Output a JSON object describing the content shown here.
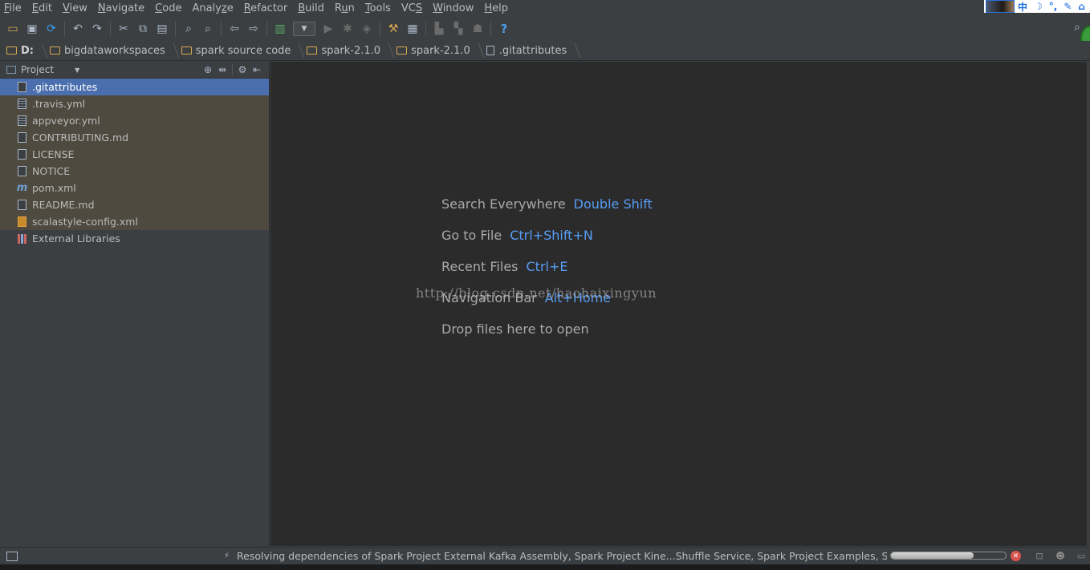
{
  "menubar": {
    "items": [
      {
        "mnemonic": "F",
        "rest": "ile"
      },
      {
        "mnemonic": "E",
        "rest": "dit"
      },
      {
        "mnemonic": "V",
        "rest": "iew"
      },
      {
        "mnemonic": "N",
        "rest": "avigate"
      },
      {
        "mnemonic": "C",
        "rest": "ode"
      },
      {
        "pre": "Analy",
        "mnemonic": "z",
        "rest": "e"
      },
      {
        "mnemonic": "R",
        "rest": "efactor"
      },
      {
        "mnemonic": "B",
        "rest": "uild"
      },
      {
        "pre": "R",
        "mnemonic": "u",
        "rest": "n"
      },
      {
        "mnemonic": "T",
        "rest": "ools"
      },
      {
        "pre": "VC",
        "mnemonic": "S",
        "rest": ""
      },
      {
        "mnemonic": "W",
        "rest": "indow"
      },
      {
        "mnemonic": "H",
        "rest": "elp"
      }
    ],
    "tray_glyphs": [
      "中",
      "☽",
      "°,",
      "✎",
      "⌂"
    ]
  },
  "breadcrumb": {
    "drive": "D:",
    "items": [
      "bigdataworkspaces",
      "spark source code",
      "spark-2.1.0",
      "spark-2.1.0"
    ],
    "file": ".gitattributes"
  },
  "project_panel": {
    "title": "Project",
    "files": [
      {
        "name": ".gitattributes",
        "icon": "file",
        "state": "selected"
      },
      {
        "name": ".travis.yml",
        "icon": "yml",
        "state": "ignored"
      },
      {
        "name": "appveyor.yml",
        "icon": "yml",
        "state": "ignored"
      },
      {
        "name": "CONTRIBUTING.md",
        "icon": "file",
        "state": "ignored"
      },
      {
        "name": "LICENSE",
        "icon": "file",
        "state": "ignored"
      },
      {
        "name": "NOTICE",
        "icon": "file",
        "state": "ignored"
      },
      {
        "name": "pom.xml",
        "icon": "maven",
        "state": "ignored"
      },
      {
        "name": "README.md",
        "icon": "file",
        "state": "ignored"
      },
      {
        "name": "scalastyle-config.xml",
        "icon": "xmlcfg",
        "state": "ignored"
      },
      {
        "name": "External Libraries",
        "icon": "lib",
        "state": "plain"
      }
    ]
  },
  "editor": {
    "hints": [
      {
        "label": "Search Everywhere",
        "key": "Double Shift"
      },
      {
        "label": "Go to File",
        "key": "Ctrl+Shift+N"
      },
      {
        "label": "Recent Files",
        "key": "Ctrl+E"
      },
      {
        "label": "Navigation Bar",
        "key": "Alt+Home"
      },
      {
        "label": "Drop files here to open",
        "key": ""
      }
    ],
    "watermark": "http://blog.csdn.net/haohaixingyun"
  },
  "statusbar": {
    "message": "Resolving dependencies of Spark Project External Kafka Assembly, Spark Project Kine...Shuffle Service, Spark Project Examples, Spark Pro...",
    "progress": 0.72
  },
  "colors": {
    "accent_link": "#589df6",
    "selection": "#4b6eaf",
    "ignored_bg": "#4e4a3f",
    "editor_bg": "#2b2b2b",
    "panel_bg": "#3c3f41"
  }
}
